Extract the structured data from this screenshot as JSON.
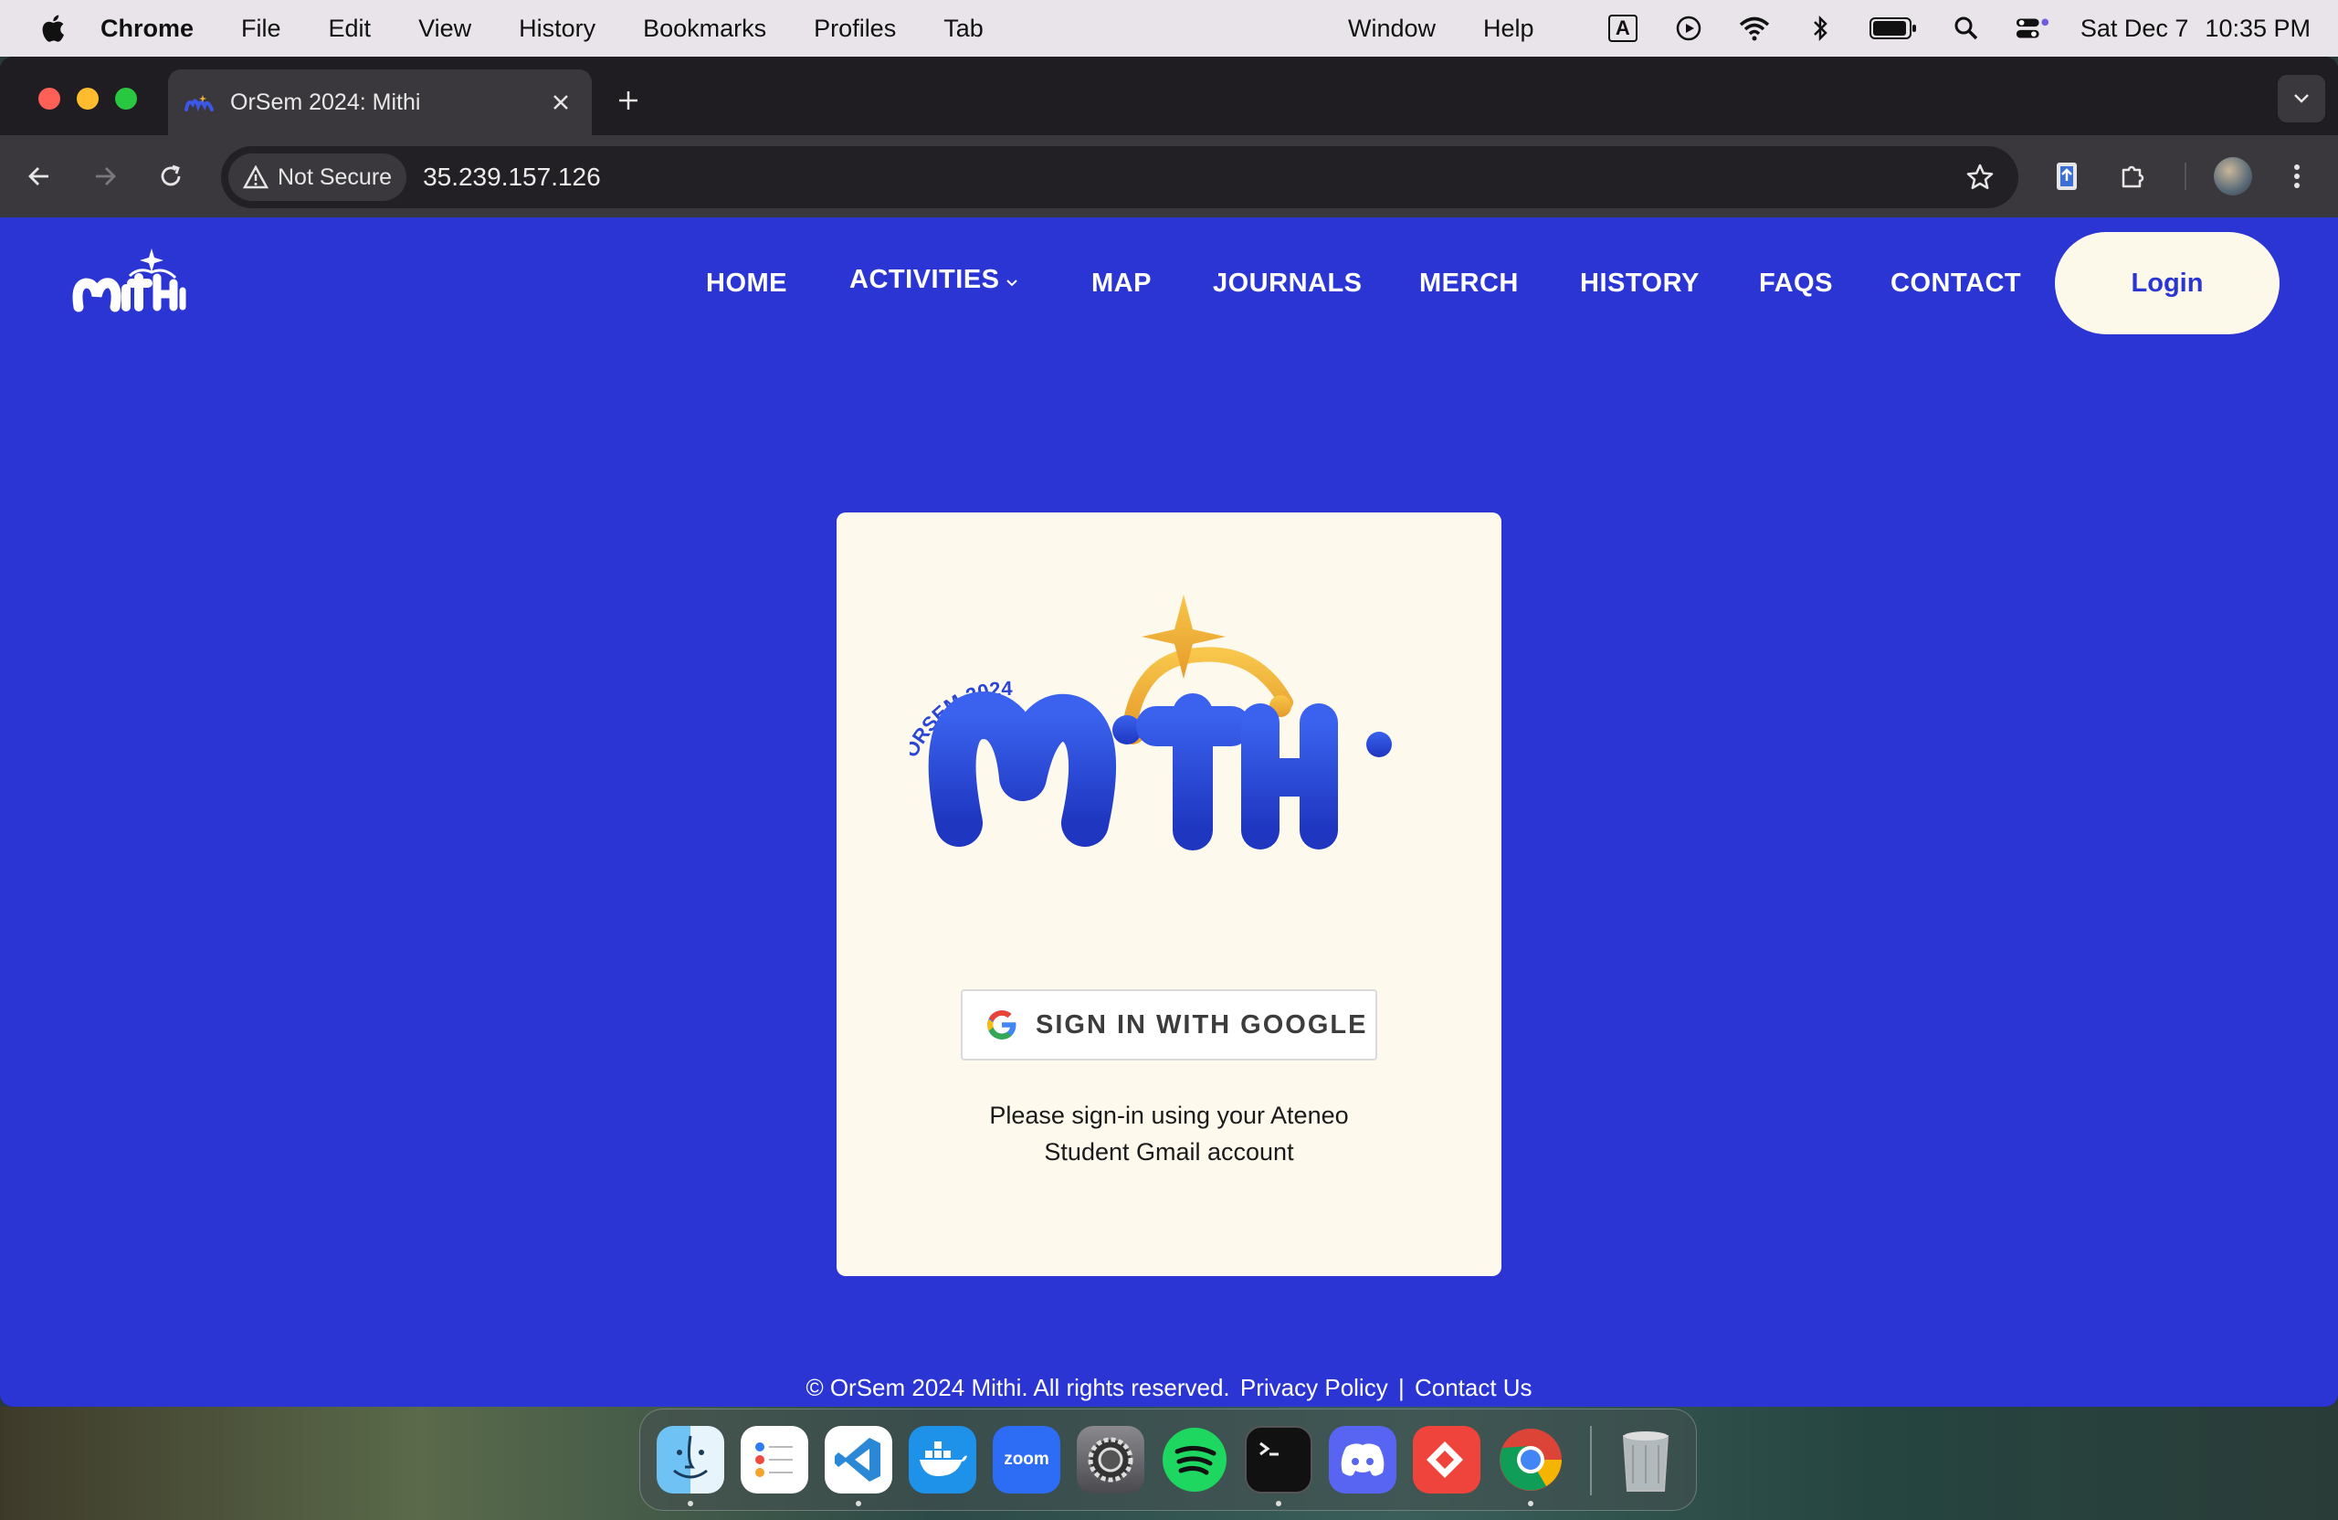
{
  "menubar": {
    "app": "Chrome",
    "items": [
      "File",
      "Edit",
      "View",
      "History",
      "Bookmarks",
      "Profiles",
      "Tab",
      "Window",
      "Help"
    ],
    "input_indicator": "A",
    "date": "Sat Dec 7",
    "time": "10:35 PM"
  },
  "browser": {
    "tab_title": "OrSem 2024: Mithi",
    "security_label": "Not Secure",
    "url": "35.239.157.126"
  },
  "site": {
    "nav": [
      "HOME",
      "ACTIVITIES",
      "MAP",
      "JOURNALS",
      "MERCH",
      "HISTORY",
      "FAQS",
      "CONTACT"
    ],
    "login": "Login",
    "logo_text": "ORSEM 2024",
    "logo_word": "MiTHi",
    "google_button": "SIGN IN WITH GOOGLE",
    "hint_line1": "Please sign-in using your Ateneo",
    "hint_line2": "Student Gmail account",
    "footer_copy": "© OrSem 2024 Mithi. All rights reserved.",
    "footer_privacy": "Privacy Policy",
    "footer_sep": "|",
    "footer_contact": "Contact Us"
  },
  "colors": {
    "brand_blue": "#2b35d4",
    "cream": "#fdf9ec",
    "gold": "#f2b33a"
  },
  "dock": {
    "apps": [
      "finder-icon",
      "reminders-icon",
      "vscode-icon",
      "docker-icon",
      "zoom-icon",
      "system-settings-icon",
      "spotify-icon",
      "terminal-icon",
      "discord-icon",
      "anydesk-icon",
      "chrome-icon",
      "trash-icon"
    ],
    "zoom_label": "zoom"
  }
}
